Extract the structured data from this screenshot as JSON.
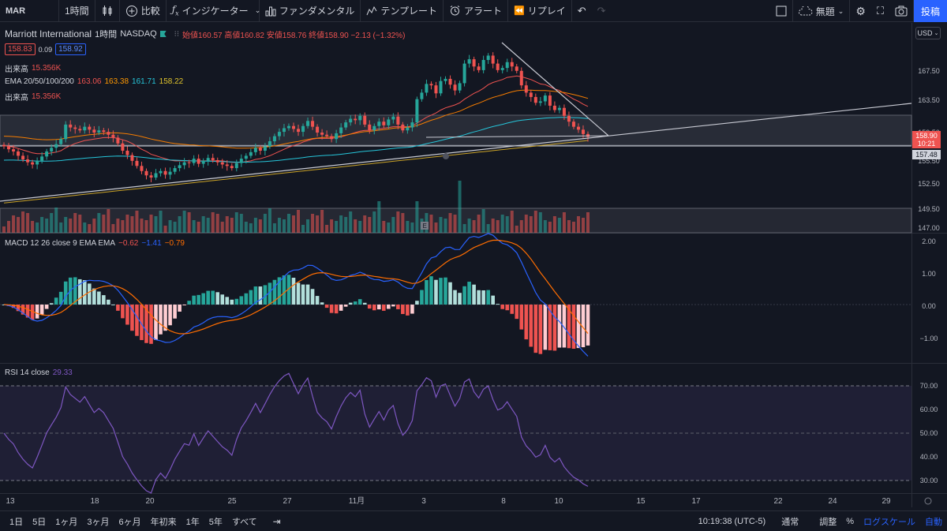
{
  "toolbar": {
    "symbol": "MAR",
    "interval": "1時間",
    "compare": "比較",
    "indicators": "インジケーター",
    "fundamentals": "ファンダメンタル",
    "templates": "テンプレート",
    "alert": "アラート",
    "replay": "リプレイ",
    "layout": "無題",
    "publish": "投稿"
  },
  "legend": {
    "name": "Marriott International",
    "interval": "1時間",
    "exchange": "NASDAQ",
    "ohlc": "始値160.57 高値160.82 安値158.76 終値158.90 −2.13 (−1.32%)",
    "bid": "158.83",
    "spread": "0.09",
    "ask": "158.92",
    "volume_label": "出来高",
    "volume_value": "15.356K",
    "ema_label": "EMA 20/50/100/200",
    "ema20": "163.06",
    "ema50": "163.38",
    "ema100": "161.71",
    "ema200": "158.22",
    "volume2_label": "出来高",
    "volume2_value": "15.356K",
    "macd_label": "MACD 12 26 close 9 EMA EMA",
    "macd_hist": "−0.62",
    "macd_line": "−1.41",
    "macd_signal": "−0.79",
    "rsi_label": "RSI 14 close",
    "rsi_value": "29.33"
  },
  "axis": {
    "currency": "USD",
    "price_ticks": [
      "167.50",
      "163.50",
      "159.50",
      "155.50",
      "152.50",
      "149.50",
      "147.00"
    ],
    "last_price": "158.90",
    "countdown": "10:21",
    "support_price": "157.48",
    "macd_ticks": [
      "2.00",
      "1.00",
      "0.00",
      "−1.00"
    ],
    "rsi_ticks": [
      "70.00",
      "60.00",
      "50.00",
      "40.00",
      "30.00"
    ],
    "time_ticks": [
      "13",
      "18",
      "20",
      "25",
      "27",
      "11月",
      "3",
      "8",
      "10",
      "15",
      "17",
      "22",
      "24",
      "29"
    ]
  },
  "bottombar": {
    "ranges": [
      "1日",
      "5日",
      "1ヶ月",
      "3ヶ月",
      "6ヶ月",
      "年初来",
      "1年",
      "5年",
      "すべて"
    ],
    "clock": "10:19:38 (UTC-5)",
    "session": "通常",
    "adjust": "調整",
    "percent": "%",
    "log": "ログスケール",
    "auto": "自動"
  },
  "colors": {
    "up": "#26a69a",
    "down": "#ef5350",
    "ema20": "#ef5350",
    "ema50": "#f57c00",
    "ema100": "#26c6da",
    "ema200": "#c9a227",
    "macd": "#2962ff",
    "signal": "#ff6d00",
    "rsi": "#7e57c2",
    "accent": "#2962ff"
  },
  "chart_data": {
    "type": "candlestick",
    "close": [
      157.6,
      157.2,
      156.9,
      156.3,
      155.8,
      155.4,
      155.1,
      155.6,
      156.2,
      156.9,
      157.4,
      157.9,
      158.6,
      160.6,
      160.2,
      160.0,
      159.8,
      160.3,
      159.9,
      159.5,
      159.8,
      159.6,
      159.2,
      158.8,
      158.0,
      157.0,
      156.4,
      155.6,
      154.9,
      154.2,
      153.6,
      153.3,
      153.9,
      154.2,
      153.7,
      154.1,
      154.6,
      155.0,
      155.4,
      155.3,
      155.9,
      155.2,
      155.6,
      156.0,
      155.7,
      155.4,
      155.1,
      154.9,
      154.6,
      155.3,
      155.9,
      156.3,
      156.8,
      157.4,
      157.0,
      157.6,
      158.3,
      159.0,
      159.6,
      160.1,
      160.4,
      160.0,
      159.6,
      160.4,
      161.1,
      160.3,
      159.5,
      159.2,
      159.0,
      158.6,
      159.4,
      160.2,
      160.9,
      161.4,
      161.2,
      161.8,
      160.6,
      159.8,
      160.4,
      161.0,
      160.5,
      161.3,
      161.7,
      160.6,
      159.8,
      160.2,
      160.9,
      164.1,
      165.0,
      166.2,
      166.0,
      164.9,
      166.6,
      166.9,
      166.1,
      165.3,
      166.3,
      169.0,
      169.6,
      168.6,
      168.1,
      169.5,
      170.1,
      169.0,
      168.1,
      168.4,
      169.2,
      168.6,
      168.0,
      166.0,
      165.0,
      164.4,
      163.6,
      163.8,
      164.6,
      163.2,
      162.6,
      162.9,
      161.8,
      161.0,
      160.3,
      159.9,
      159.3,
      158.9
    ],
    "ema20": [
      157.7,
      157.6,
      157.5,
      157.3,
      157.1,
      156.9,
      156.7,
      156.6,
      156.6,
      156.6,
      156.7,
      156.8,
      157.0,
      157.4,
      157.7,
      158.0,
      158.2,
      158.4,
      158.5,
      158.6,
      158.7,
      158.8,
      158.8,
      158.8,
      158.7,
      158.5,
      158.3,
      158.0,
      157.6,
      157.2,
      156.9,
      156.5,
      156.3,
      156.1,
      155.9,
      155.7,
      155.6,
      155.6,
      155.6,
      155.6,
      155.6,
      155.6,
      155.6,
      155.6,
      155.6,
      155.6,
      155.6,
      155.5,
      155.4,
      155.4,
      155.4,
      155.5,
      155.6,
      155.8,
      155.9,
      156.1,
      156.3,
      156.6,
      156.9,
      157.2,
      157.5,
      157.7,
      157.9,
      158.2,
      158.4,
      158.6,
      158.7,
      158.7,
      158.7,
      158.7,
      158.8,
      158.9,
      159.1,
      159.3,
      159.5,
      159.7,
      159.8,
      159.8,
      159.9,
      160.0,
      160.1,
      160.2,
      160.3,
      160.3,
      160.3,
      160.3,
      160.4,
      160.8,
      161.2,
      161.6,
      161.9,
      162.2,
      162.6,
      162.9,
      163.1,
      163.3,
      163.6,
      164.1,
      164.5,
      164.9,
      165.2,
      165.6,
      166.1,
      166.4,
      166.6,
      166.8,
      167.1,
      167.2,
      167.3,
      167.2,
      167.0,
      166.8,
      166.5,
      166.2,
      166.1,
      165.8,
      165.5,
      165.3,
      164.9,
      164.5,
      164.1,
      163.8,
      163.4,
      163.1
    ]
  }
}
